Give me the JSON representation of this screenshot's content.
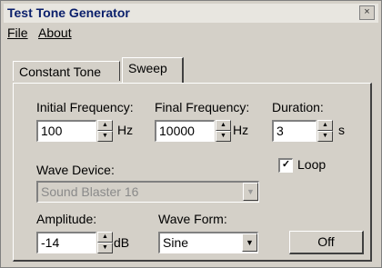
{
  "window": {
    "title": "Test Tone Generator",
    "close_glyph": "×"
  },
  "menu": {
    "file": "File",
    "about": "About"
  },
  "tabs": [
    {
      "label": "Constant Tone"
    },
    {
      "label": "Sweep"
    }
  ],
  "sweep": {
    "initial_frequency": {
      "label": "Initial Frequency:",
      "value": "100",
      "unit": "Hz"
    },
    "final_frequency": {
      "label": "Final Frequency:",
      "value": "10000",
      "unit": "Hz"
    },
    "duration": {
      "label": "Duration:",
      "value": "3",
      "unit": "s"
    },
    "loop": {
      "label": "Loop",
      "checked": true
    },
    "wave_device": {
      "label": "Wave Device:",
      "value": "Sound Blaster 16"
    },
    "amplitude": {
      "label": "Amplitude:",
      "value": "-14",
      "unit": "dB"
    },
    "wave_form": {
      "label": "Wave Form:",
      "value": "Sine"
    },
    "off_button": "Off"
  }
}
